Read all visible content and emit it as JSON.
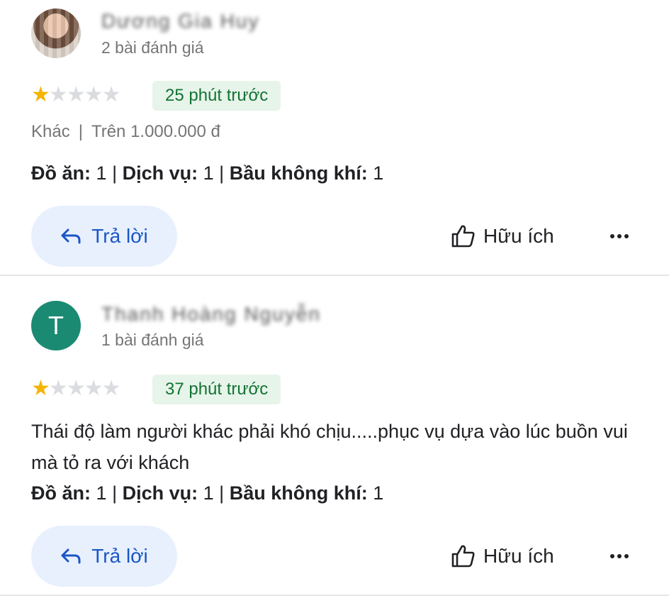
{
  "reviews": [
    {
      "name": "Dương Gia Huy",
      "count": "2 bài đánh giá",
      "rating": 1,
      "time": "25 phút trước",
      "category": "Khác",
      "price": "Trên 1.000.000 đ",
      "text": "",
      "ratings": {
        "food_label": "Đồ ăn:",
        "food": "1",
        "service_label": "Dịch vụ:",
        "service": "1",
        "atmosphere_label": "Bầu không khí:",
        "atmosphere": "1"
      }
    },
    {
      "avatar_letter": "T",
      "name": "Thanh Hoàng Nguyễn",
      "count": "1 bài đánh giá",
      "rating": 1,
      "time": "37 phút trước",
      "text": "Thái độ làm người khác phải khó chịu.....phục vụ dựa vào lúc buồn vui mà tỏ ra với khách",
      "ratings": {
        "food_label": "Đồ ăn:",
        "food": "1",
        "service_label": "Dịch vụ:",
        "service": "1",
        "atmosphere_label": "Bầu không khí:",
        "atmosphere": "1"
      }
    }
  ],
  "actions": {
    "reply": "Trả lời",
    "helpful": "Hữu ích"
  },
  "colors": {
    "star": "#f5b400",
    "accent": "#1a56c4",
    "avatar": "#1a8a73",
    "time_bg": "#e6f4ea"
  },
  "icons": {
    "reply": "reply-arrow-icon",
    "helpful": "thumbs-up-icon",
    "more": "more-horizontal-icon"
  }
}
